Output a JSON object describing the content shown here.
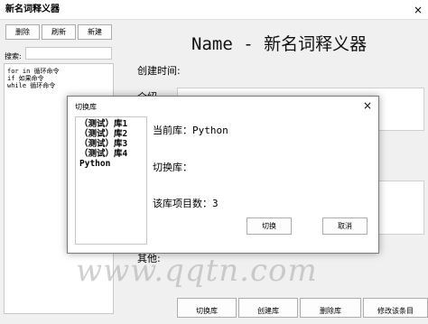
{
  "window": {
    "title": "新名词释义器",
    "close_glyph": "×"
  },
  "toolbar": {
    "delete_label": "删除",
    "refresh_label": "刷新",
    "new_label": "新建"
  },
  "search": {
    "label": "搜索:",
    "value": ""
  },
  "commands": [
    "for in 循环命令",
    "if 如果命令",
    "while 循环命令"
  ],
  "main": {
    "title": "Name - 新名词释义器",
    "created_label": "创建时间:",
    "intro_label": "介绍",
    "other_label": "其他:"
  },
  "bottom_buttons": {
    "switch_lib": "切换库",
    "create_lib": "创建库",
    "delete_lib": "删除库",
    "modify_item": "修改该条目"
  },
  "dialog": {
    "title": "切换库",
    "close_glyph": "×",
    "libraries": [
      "（测试）库1",
      "（测试）库2",
      "（测试）库3",
      "（测试）库4",
      "Python"
    ],
    "current_lib_label": "当前库：Python",
    "switch_to_label": "切换库：",
    "item_count_label": "该库项目数：3",
    "switch_button": "切换",
    "cancel_button": "取消"
  },
  "watermark": "www.qqtn.com"
}
